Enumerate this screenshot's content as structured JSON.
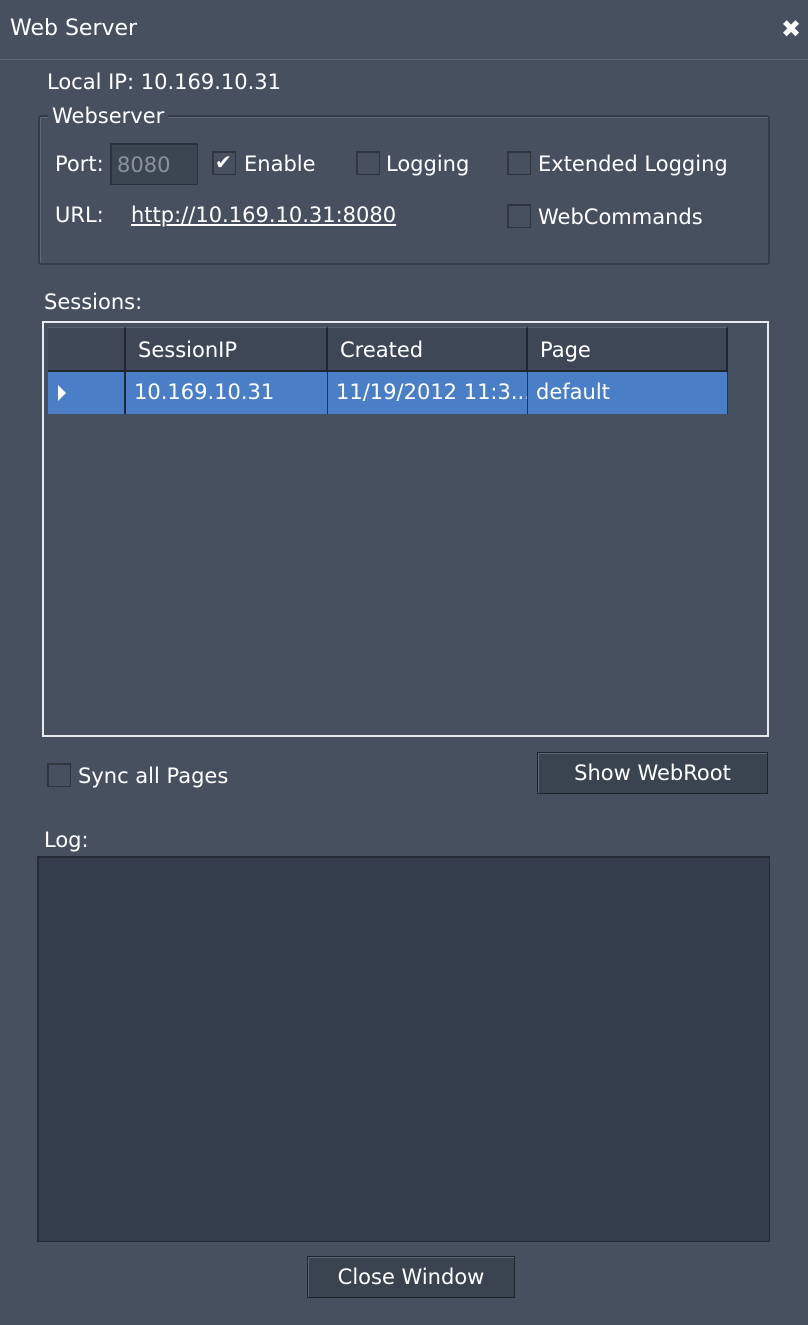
{
  "window": {
    "title": "Web Server",
    "close_glyph": "✖"
  },
  "local_ip": {
    "label": "Local IP:",
    "value": "10.169.10.31"
  },
  "webserver": {
    "legend": "Webserver",
    "port_label": "Port:",
    "port_value": "8080",
    "enable_label": "Enable",
    "enable_checked": true,
    "logging_label": "Logging",
    "logging_checked": false,
    "extended_logging_label": "Extended Logging",
    "extended_logging_checked": false,
    "url_label": "URL:",
    "url_value": "http://10.169.10.31:8080",
    "webcommands_label": "WebCommands",
    "webcommands_checked": false
  },
  "sessions": {
    "label": "Sessions:",
    "columns": [
      "SessionIP",
      "Created",
      "Page"
    ],
    "rows": [
      {
        "session_ip": "10.169.10.31",
        "created": "11/19/2012 11:3...",
        "page": "default",
        "selected": true
      }
    ]
  },
  "sync_all_pages": {
    "label": "Sync all Pages",
    "checked": false
  },
  "show_webroot_button": "Show WebRoot",
  "log": {
    "label": "Log:",
    "content": ""
  },
  "close_window_button": "Close Window",
  "colors": {
    "background": "#46505f",
    "selection": "#4a7fc7",
    "log_background": "#333d4b",
    "text": "#ffffff"
  }
}
